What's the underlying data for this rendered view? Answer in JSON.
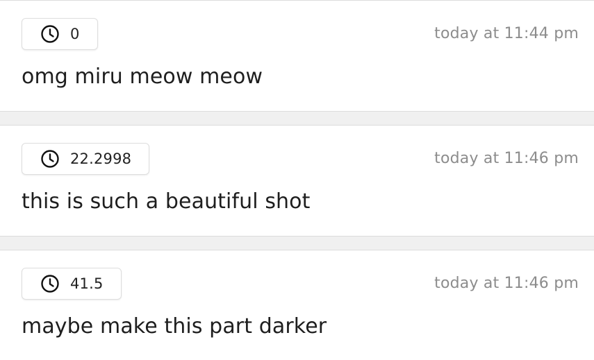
{
  "comments": [
    {
      "timecode": "0",
      "posted": "today at 11:44 pm",
      "text": "omg miru meow meow"
    },
    {
      "timecode": "22.2998",
      "posted": "today at 11:46 pm",
      "text": "this is such a beautiful shot"
    },
    {
      "timecode": "41.5",
      "posted": "today at 11:46 pm",
      "text": "maybe make this part darker"
    }
  ],
  "icons": {
    "timecode": "clock-icon"
  }
}
